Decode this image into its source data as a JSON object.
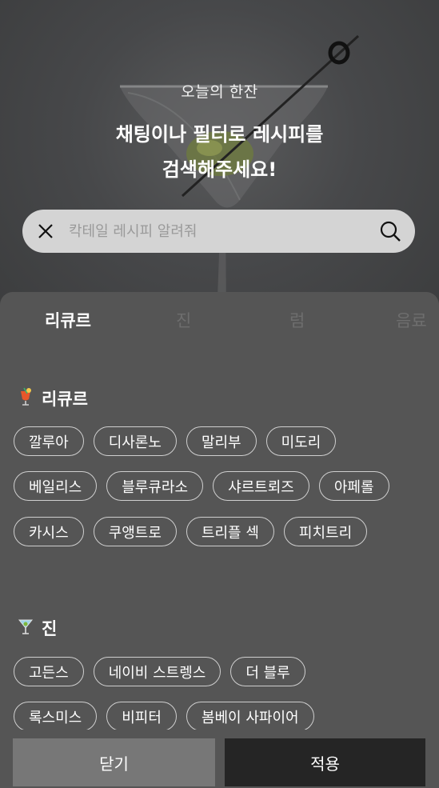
{
  "hero": {
    "subtitle": "오늘의 한잔",
    "title_line1": "채팅이나 필터로 레시피를",
    "title_line2": "검색해주세요!"
  },
  "search": {
    "placeholder": "칵테일 레시피 알려줘",
    "value": "",
    "clear_icon": "close-icon",
    "search_icon": "search-icon"
  },
  "tabs": [
    {
      "label": "리큐르",
      "active": true
    },
    {
      "label": "진",
      "active": false
    },
    {
      "label": "럼",
      "active": false
    },
    {
      "label": "음료",
      "active": false
    }
  ],
  "sections": [
    {
      "title": "리큐르",
      "icon": "cocktail-glass-icon",
      "rows": [
        [
          "깔루아",
          "디사론노",
          "말리부",
          "미도리"
        ],
        [
          "베일리스",
          "블루큐라소",
          "샤르트뢰즈",
          "아페롤"
        ],
        [
          "카시스",
          "쿠앵트로",
          "트리플 섹",
          "피치트리"
        ]
      ]
    },
    {
      "title": "진",
      "icon": "martini-glass-icon",
      "rows": [
        [
          "고든스",
          "네이비 스트렝스",
          "더 블루"
        ],
        [
          "록스미스",
          "비피터",
          "봄베이 사파이어"
        ]
      ]
    }
  ],
  "footer": {
    "close_label": "닫기",
    "apply_label": "적용"
  },
  "colors": {
    "sheet": "#555555",
    "chip_border": "#cfcfcf",
    "close_button": "#777777",
    "apply_button": "#252525",
    "search_bar": "#d4d4d4"
  }
}
